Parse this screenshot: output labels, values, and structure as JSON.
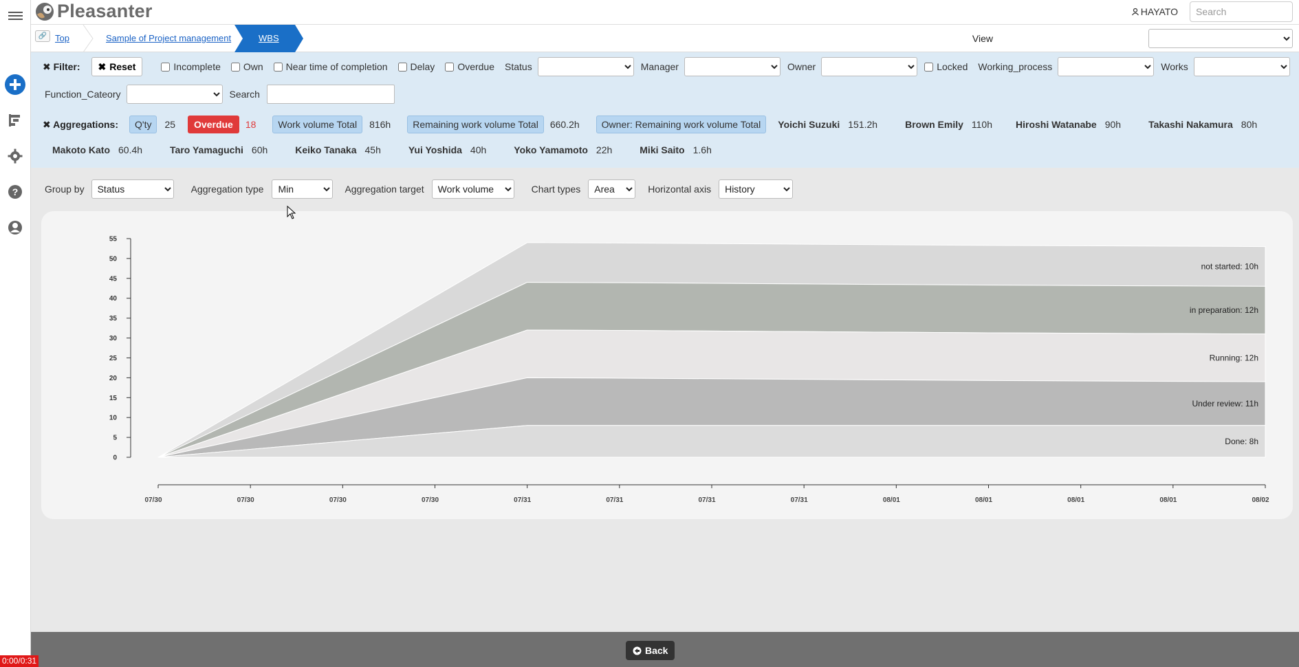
{
  "header": {
    "app_name": "Pleasanter",
    "user_name": "HAYATO",
    "search_placeholder": "Search"
  },
  "breadcrumb": {
    "items": [
      "Top",
      "Sample of Project management",
      "WBS"
    ],
    "view_label": "View",
    "view_value": ""
  },
  "filter": {
    "title": "Filter:",
    "reset_label": "Reset",
    "checkboxes": [
      "Incomplete",
      "Own",
      "Near time of completion",
      "Delay",
      "Overdue",
      "Locked"
    ],
    "status_label": "Status",
    "manager_label": "Manager",
    "owner_label": "Owner",
    "working_process_label": "Working_process",
    "works_label": "Works",
    "function_category_label": "Function_Cateory",
    "search_label": "Search"
  },
  "aggregations": {
    "title": "Aggregations:",
    "qty_label": "Q'ty",
    "qty_value": "25",
    "overdue_label": "Overdue",
    "overdue_value": "18",
    "work_volume_label": "Work volume Total",
    "work_volume_value": "816h",
    "remaining_label": "Remaining work volume Total",
    "remaining_value": "660.2h",
    "owner_remaining_label": "Owner: Remaining work volume Total",
    "owners": [
      {
        "name": "Yoichi Suzuki",
        "value": "151.2h"
      },
      {
        "name": "Brown Emily",
        "value": "110h"
      },
      {
        "name": "Hiroshi Watanabe",
        "value": "90h"
      },
      {
        "name": "Takashi Nakamura",
        "value": "80h"
      },
      {
        "name": "Makoto Kato",
        "value": "60.4h"
      },
      {
        "name": "Taro Yamaguchi",
        "value": "60h"
      },
      {
        "name": "Keiko Tanaka",
        "value": "45h"
      },
      {
        "name": "Yui Yoshida",
        "value": "40h"
      },
      {
        "name": "Yoko Yamamoto",
        "value": "22h"
      },
      {
        "name": "Miki Saito",
        "value": "1.6h"
      }
    ]
  },
  "chart_options": {
    "group_by_label": "Group by",
    "group_by_value": "Status",
    "aggregation_type_label": "Aggregation type",
    "aggregation_type_value": "Min",
    "aggregation_target_label": "Aggregation target",
    "aggregation_target_value": "Work volume",
    "chart_types_label": "Chart types",
    "chart_types_value": "Area",
    "horizontal_axis_label": "Horizontal axis",
    "horizontal_axis_value": "History"
  },
  "chart_data": {
    "type": "area",
    "stacked": true,
    "title": "",
    "xlabel": "",
    "ylabel": "",
    "ylim": [
      0,
      55
    ],
    "yticks": [
      0,
      5,
      10,
      15,
      20,
      25,
      30,
      35,
      40,
      45,
      50,
      55
    ],
    "x": [
      "07/30",
      "07/30",
      "07/30",
      "07/30",
      "07/31",
      "07/31",
      "07/31",
      "07/31",
      "08/01",
      "08/01",
      "08/01",
      "08/01",
      "08/02"
    ],
    "series": [
      {
        "name": "Done",
        "label": "Done: 8h",
        "color": "#dcdcdc",
        "values": [
          0,
          2,
          4,
          6,
          8,
          8,
          8,
          8,
          8,
          8,
          8,
          8,
          8
        ]
      },
      {
        "name": "Under review",
        "label": "Under review: 11h",
        "color": "#b9b9b9",
        "values": [
          0,
          3,
          6,
          9,
          12,
          11.9,
          11.75,
          11.6,
          11.45,
          11.3,
          11.2,
          11.1,
          11
        ]
      },
      {
        "name": "Running",
        "label": "Running: 12h",
        "color": "#e8e6e6",
        "values": [
          0,
          3,
          6,
          9,
          12,
          12,
          12,
          12,
          12,
          12,
          12,
          12,
          12
        ]
      },
      {
        "name": "in preparation",
        "label": "in preparation: 12h",
        "color": "#b2b6b0",
        "values": [
          0,
          3,
          6,
          9,
          12,
          12,
          12,
          12,
          12,
          12,
          12,
          12,
          12
        ]
      },
      {
        "name": "not started",
        "label": "not started: 10h",
        "color": "#d9d9d9",
        "values": [
          0,
          2.5,
          5,
          7.5,
          10,
          10,
          10,
          10,
          10,
          10,
          10,
          10,
          10
        ]
      }
    ]
  },
  "footer": {
    "back_label": "Back",
    "timer": "0:00/0:31"
  }
}
